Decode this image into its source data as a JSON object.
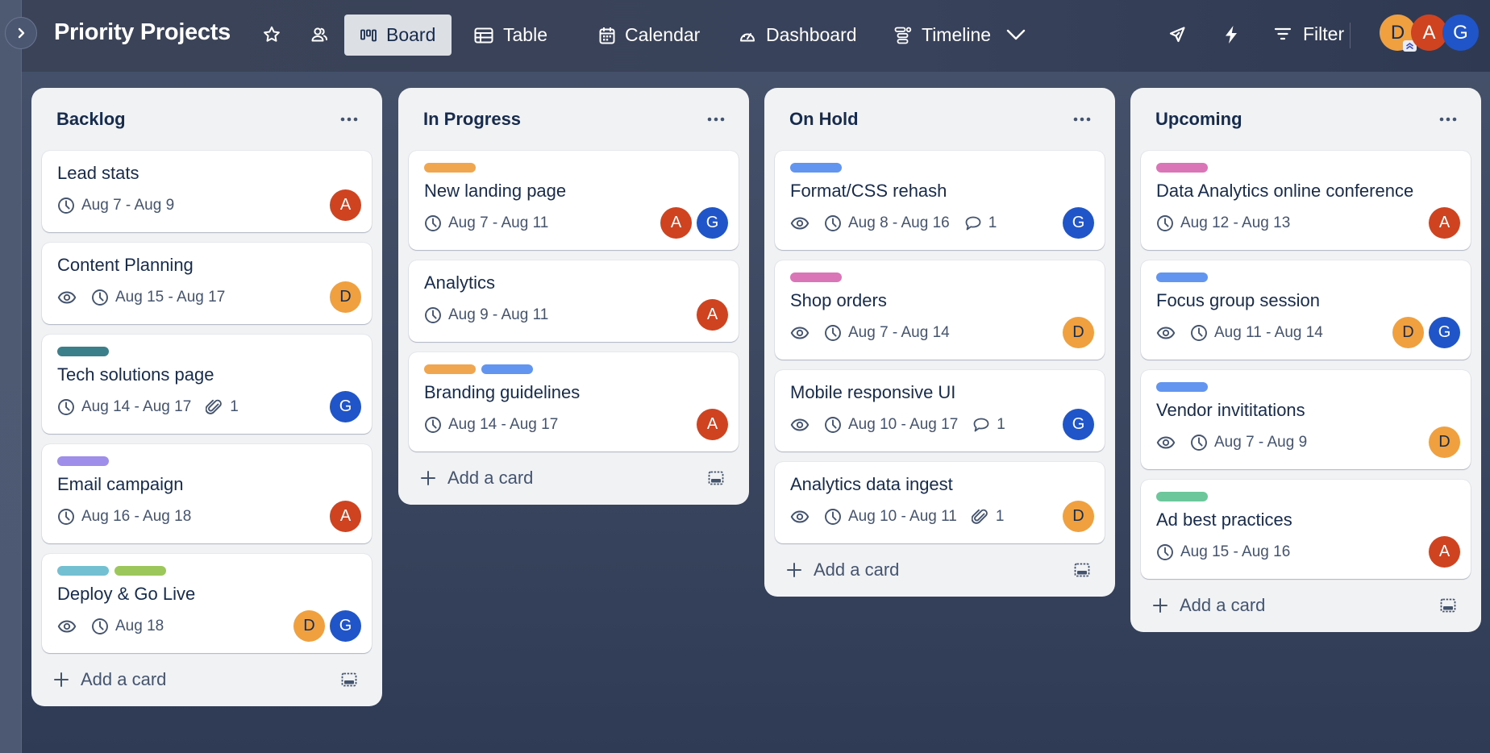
{
  "header": {
    "title": "Priority Projects",
    "views": [
      {
        "label": "Board",
        "icon": "board-icon",
        "active": true
      },
      {
        "label": "Table",
        "icon": "table-icon",
        "active": false
      },
      {
        "label": "Calendar",
        "icon": "calendar-icon",
        "active": false
      },
      {
        "label": "Dashboard",
        "icon": "dashboard-icon",
        "active": false
      },
      {
        "label": "Timeline",
        "icon": "timeline-icon",
        "active": false
      }
    ],
    "filter_label": "Filter",
    "members": [
      {
        "initial": "D",
        "admin": true
      },
      {
        "initial": "A",
        "admin": false
      },
      {
        "initial": "G",
        "admin": false
      }
    ]
  },
  "colors": {
    "avatar_D": "#f0a03f",
    "avatar_A": "#d04321",
    "avatar_G": "#1f55c8",
    "label_orange": "#f0a64f",
    "label_blue": "#6195f0",
    "label_pink": "#da76b8",
    "label_teal": "#3b7f8a",
    "label_purple": "#9f8fea",
    "label_sky": "#74c0d3",
    "label_lime": "#9cc75a",
    "label_green": "#6cc79a"
  },
  "add_card_label": "Add a card",
  "columns": [
    {
      "title": "Backlog",
      "cards": [
        {
          "title": "Lead stats",
          "labels": [],
          "watch": false,
          "dates": "Aug 7 - Aug 9",
          "comments": null,
          "attachments": null,
          "members": [
            "A"
          ]
        },
        {
          "title": "Content Planning",
          "labels": [],
          "watch": true,
          "dates": "Aug 15 - Aug 17",
          "comments": null,
          "attachments": null,
          "members": [
            "D"
          ]
        },
        {
          "title": "Tech solutions page",
          "labels": [
            "#3b7f8a"
          ],
          "watch": false,
          "dates": "Aug 14 - Aug 17",
          "comments": null,
          "attachments": "1",
          "members": [
            "G"
          ]
        },
        {
          "title": "Email campaign",
          "labels": [
            "#9f8fea"
          ],
          "watch": false,
          "dates": "Aug 16 - Aug 18",
          "comments": null,
          "attachments": null,
          "members": [
            "A"
          ]
        },
        {
          "title": "Deploy & Go Live",
          "labels": [
            "#74c0d3",
            "#9cc75a"
          ],
          "watch": true,
          "dates": "Aug 18",
          "comments": null,
          "attachments": null,
          "members": [
            "D",
            "G"
          ]
        }
      ]
    },
    {
      "title": "In Progress",
      "cards": [
        {
          "title": "New landing page",
          "labels": [
            "#f0a64f"
          ],
          "watch": false,
          "dates": "Aug 7 - Aug 11",
          "comments": null,
          "attachments": null,
          "members": [
            "A",
            "G"
          ]
        },
        {
          "title": "Analytics",
          "labels": [],
          "watch": false,
          "dates": "Aug 9 - Aug 11",
          "comments": null,
          "attachments": null,
          "members": [
            "A"
          ]
        },
        {
          "title": "Branding guidelines",
          "labels": [
            "#f0a64f",
            "#6195f0"
          ],
          "watch": false,
          "dates": "Aug 14 - Aug 17",
          "comments": null,
          "attachments": null,
          "members": [
            "A"
          ]
        }
      ]
    },
    {
      "title": "On Hold",
      "cards": [
        {
          "title": "Format/CSS rehash",
          "labels": [
            "#6195f0"
          ],
          "watch": true,
          "dates": "Aug 8 - Aug 16",
          "comments": "1",
          "attachments": null,
          "members": [
            "G"
          ]
        },
        {
          "title": "Shop orders",
          "labels": [
            "#da76b8"
          ],
          "watch": true,
          "dates": "Aug 7 - Aug 14",
          "comments": null,
          "attachments": null,
          "members": [
            "D"
          ]
        },
        {
          "title": "Mobile responsive UI",
          "labels": [],
          "watch": true,
          "dates": "Aug 10 - Aug 17",
          "comments": "1",
          "attachments": null,
          "members": [
            "G"
          ]
        },
        {
          "title": "Analytics data ingest",
          "labels": [],
          "watch": true,
          "dates": "Aug 10 - Aug 11",
          "comments": null,
          "attachments": "1",
          "members": [
            "D"
          ]
        }
      ]
    },
    {
      "title": "Upcoming",
      "cards": [
        {
          "title": "Data Analytics online conference",
          "labels": [
            "#da76b8"
          ],
          "watch": false,
          "dates": "Aug 12 - Aug 13",
          "comments": null,
          "attachments": null,
          "members": [
            "A"
          ]
        },
        {
          "title": "Focus group session",
          "labels": [
            "#6195f0"
          ],
          "watch": true,
          "dates": "Aug 11 - Aug 14",
          "comments": null,
          "attachments": null,
          "members": [
            "D",
            "G"
          ]
        },
        {
          "title": "Vendor invititations",
          "labels": [
            "#6195f0"
          ],
          "watch": true,
          "dates": "Aug 7 - Aug 9",
          "comments": null,
          "attachments": null,
          "members": [
            "D"
          ]
        },
        {
          "title": "Ad best practices",
          "labels": [
            "#6cc79a"
          ],
          "watch": false,
          "dates": "Aug 15 - Aug 16",
          "comments": null,
          "attachments": null,
          "members": [
            "A"
          ]
        }
      ]
    }
  ]
}
